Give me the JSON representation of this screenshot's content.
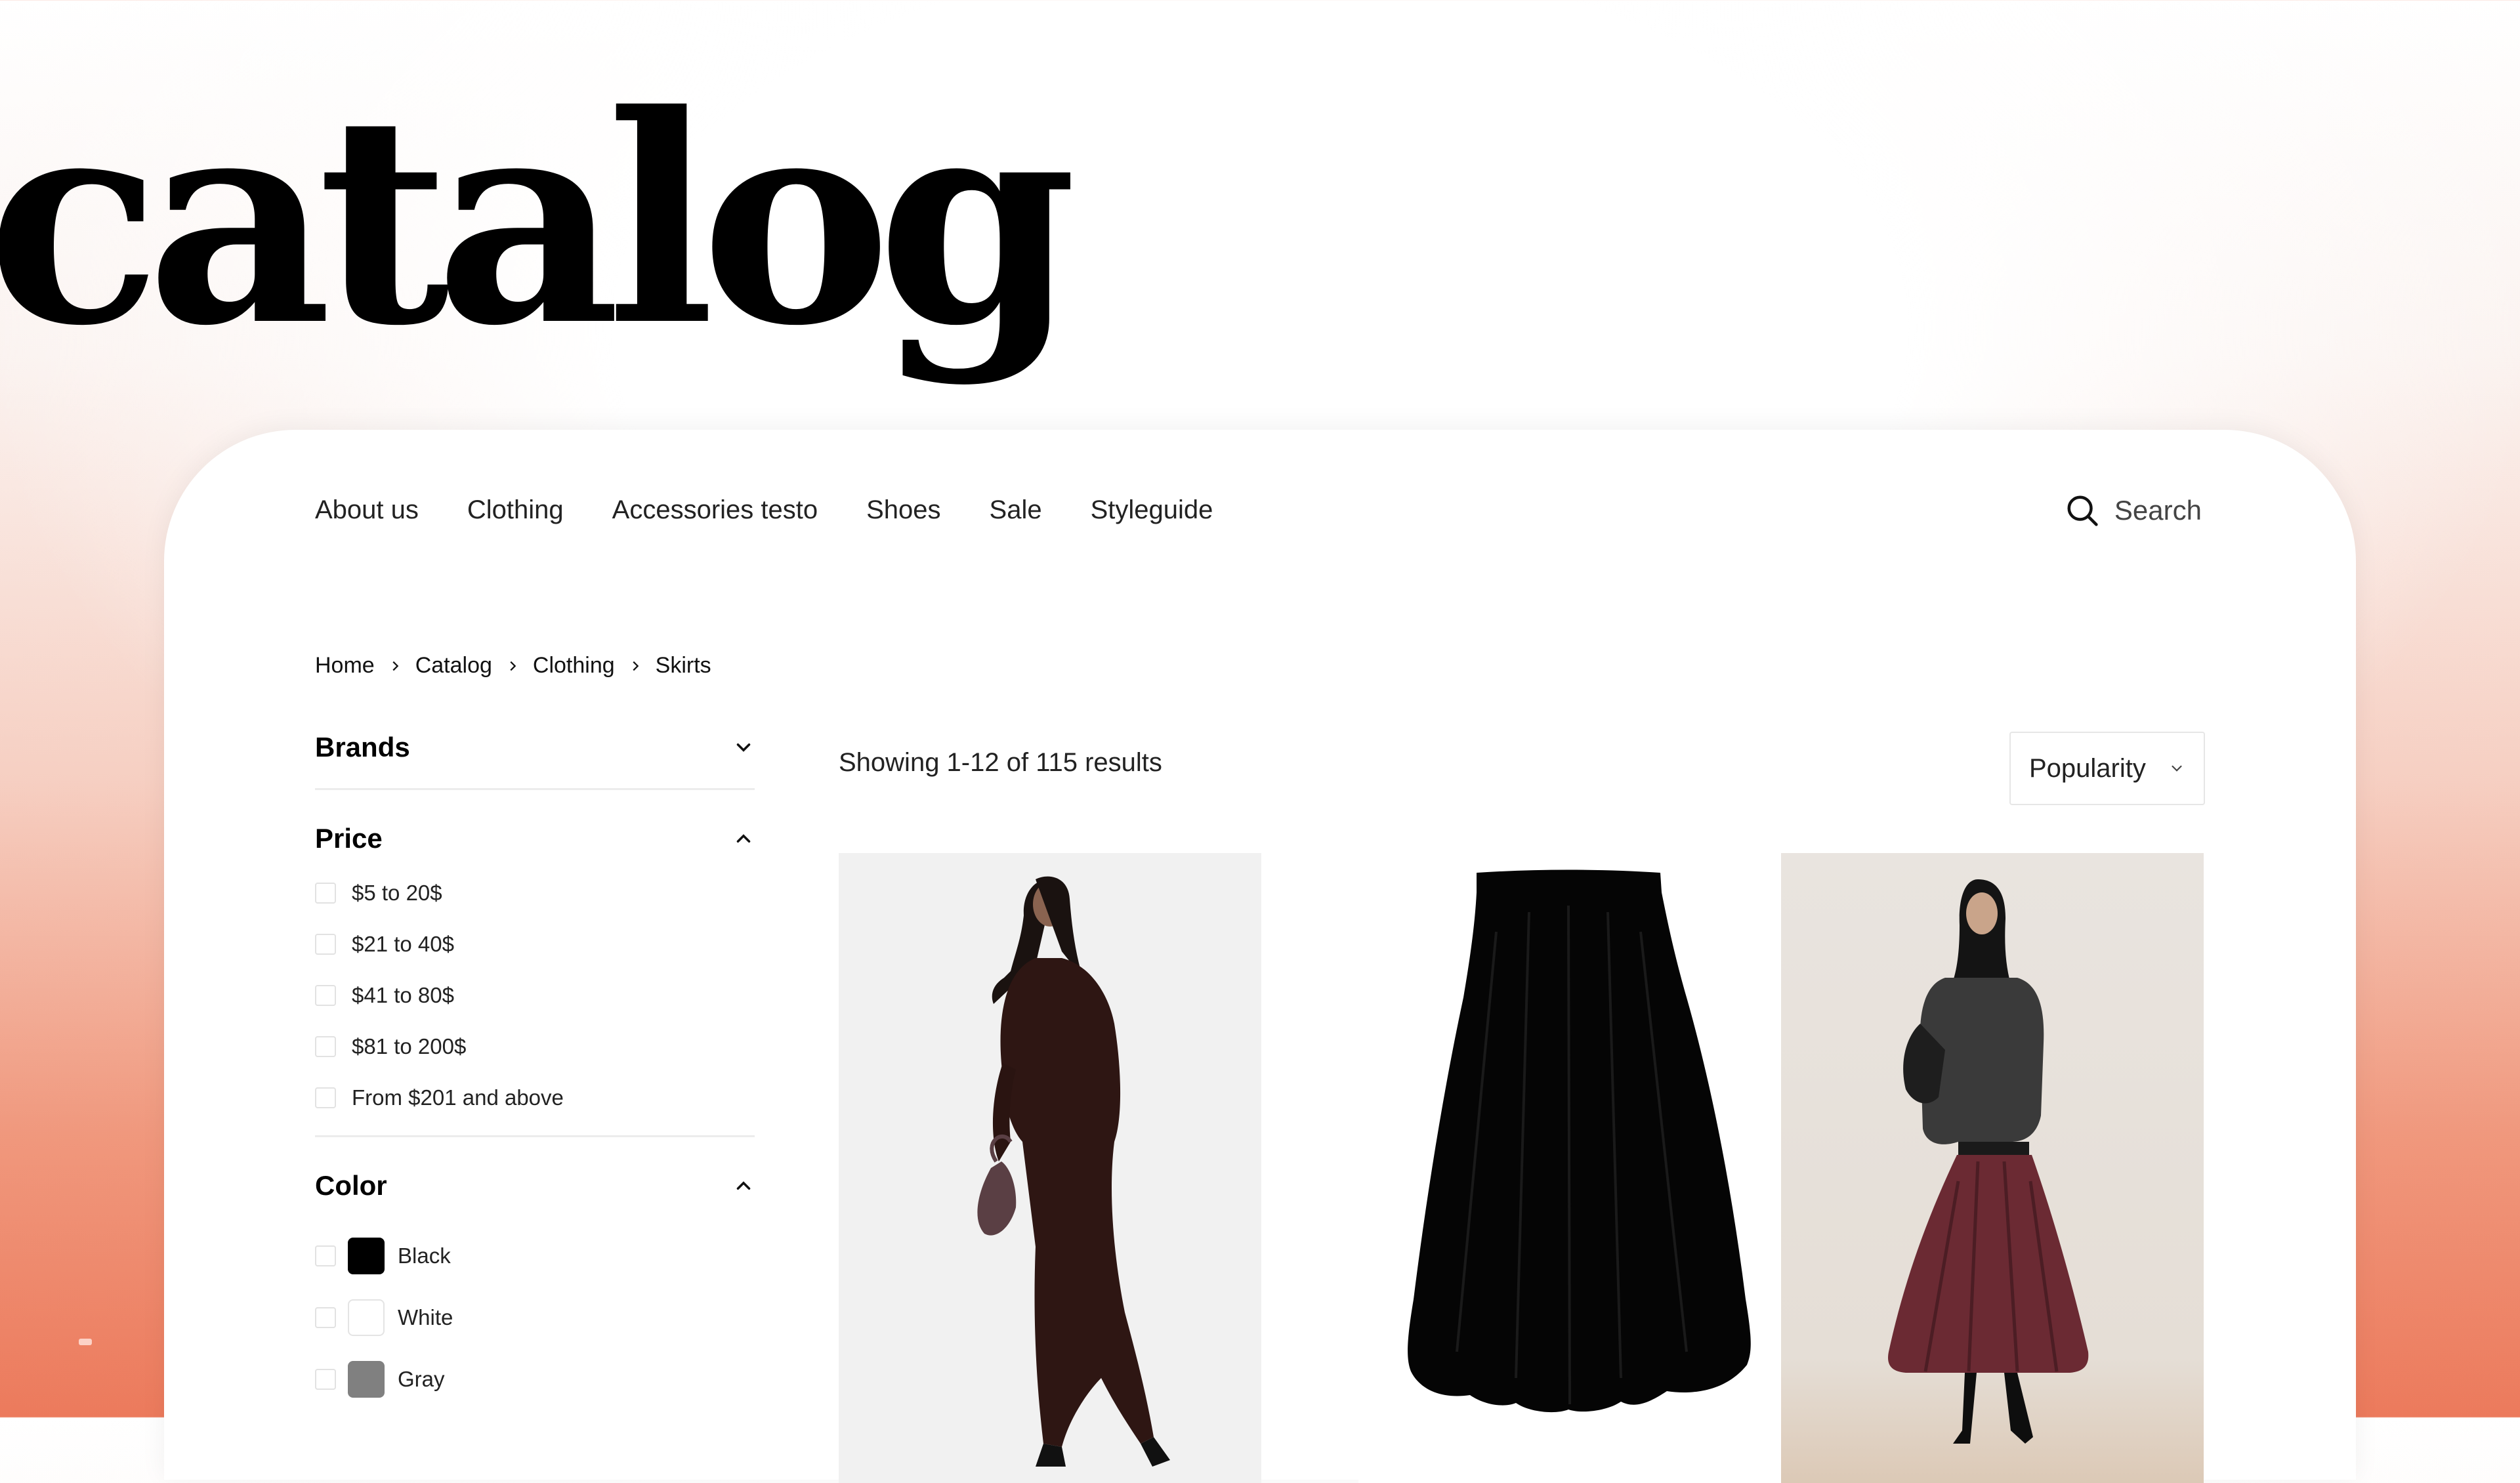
{
  "hero": {
    "title": "catalog"
  },
  "nav": {
    "items": [
      "About us",
      "Clothing",
      "Accessories testo",
      "Shoes",
      "Sale",
      "Styleguide"
    ],
    "search_label": "Search"
  },
  "breadcrumb": [
    "Home",
    "Catalog",
    "Clothing",
    "Skirts"
  ],
  "filters": {
    "brands": {
      "title": "Brands",
      "expanded": false
    },
    "price": {
      "title": "Price",
      "expanded": true,
      "options": [
        "$5 to 20$",
        "$21 to 40$",
        "$41 to 80$",
        "$81 to 200$",
        "From $201 and above"
      ]
    },
    "color": {
      "title": "Color",
      "expanded": true,
      "options": [
        {
          "label": "Black",
          "swatch": "#000000"
        },
        {
          "label": "White",
          "swatch": "#ffffff"
        },
        {
          "label": "Gray",
          "swatch": "#808080"
        }
      ]
    }
  },
  "results": {
    "text": "Showing 1-12 of 115 results"
  },
  "sort": {
    "selected": "Popularity"
  },
  "products": [
    {
      "image": "model in long dark brown knit skirt and sweater with studded handbag"
    },
    {
      "image": "black pleated midi skirt on white background"
    },
    {
      "image": "model in burgundy pleated skirt with grey top and black boots"
    }
  ],
  "colors": {
    "accent": "#ec7a5c",
    "text": "#111111"
  }
}
